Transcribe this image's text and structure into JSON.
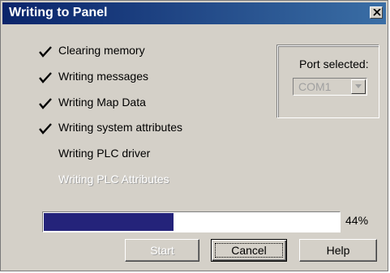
{
  "window": {
    "title": "Writing to Panel",
    "title_bar_color": "#0a246a"
  },
  "steps": [
    {
      "label": "Clearing memory",
      "checked": true,
      "enabled": true
    },
    {
      "label": "Writing messages",
      "checked": true,
      "enabled": true
    },
    {
      "label": "Writing Map Data",
      "checked": true,
      "enabled": true
    },
    {
      "label": "Writing system attributes",
      "checked": true,
      "enabled": true
    },
    {
      "label": "Writing PLC driver",
      "checked": false,
      "enabled": true
    },
    {
      "label": "Writing PLC Attributes",
      "checked": false,
      "enabled": false
    }
  ],
  "port": {
    "label": "Port selected:",
    "value": "COM1",
    "enabled": false
  },
  "progress": {
    "value_percent": 44,
    "text": "44%",
    "fill_color": "#24237a"
  },
  "buttons": {
    "start": {
      "label": "Start",
      "enabled": false
    },
    "cancel": {
      "label": "Cancel",
      "enabled": true,
      "focused": true
    },
    "help": {
      "label": "Help",
      "enabled": true
    }
  },
  "icons": {
    "close": "close-icon",
    "check": "checkmark-icon",
    "dropdown": "dropdown-arrow-icon"
  }
}
